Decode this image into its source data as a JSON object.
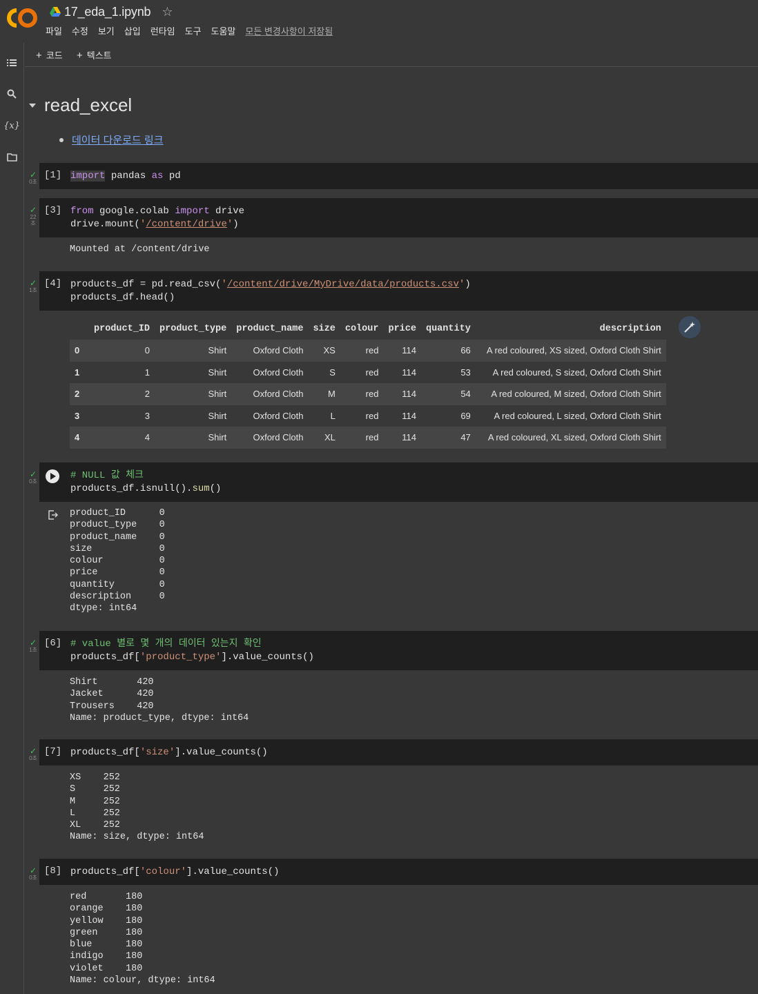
{
  "app": {
    "notebook_title": "17_eda_1.ipynb",
    "menu": [
      "파일",
      "수정",
      "보기",
      "삽입",
      "런타임",
      "도구",
      "도움말"
    ],
    "saved_status": "모든 변경사항이 저장됨"
  },
  "toolbar": {
    "add_code": "코드",
    "add_text": "텍스트"
  },
  "section": {
    "title": "read_excel",
    "link_text": "데이터 다운로드 링크"
  },
  "cells": [
    {
      "num": "[1]",
      "time": "0초",
      "lines": [
        "import pandas as pd"
      ]
    },
    {
      "num": "[3]",
      "time": "22\n초",
      "lines": [
        "from google.colab import drive",
        "drive.mount('/content/drive')"
      ],
      "output": [
        "Mounted at /content/drive"
      ]
    },
    {
      "num": "[4]",
      "time": "1초",
      "lines": [
        "products_df = pd.read_csv('/content/drive/MyDrive/data/products.csv')",
        "products_df.head()"
      ]
    },
    {
      "num": "",
      "time": "0초",
      "lines": [
        "# NULL 값 체크",
        "products_df.isnull().sum()"
      ],
      "output": [
        "product_ID      0",
        "product_type    0",
        "product_name    0",
        "size            0",
        "colour          0",
        "price           0",
        "quantity        0",
        "description     0",
        "dtype: int64"
      ]
    },
    {
      "num": "[6]",
      "time": "1초",
      "lines": [
        "# value 별로 몇 개의 데이터 있는지 확인",
        "products_df['product_type'].value_counts()"
      ],
      "output": [
        "Shirt       420",
        "Jacket      420",
        "Trousers    420",
        "Name: product_type, dtype: int64"
      ]
    },
    {
      "num": "[7]",
      "time": "0초",
      "lines": [
        "products_df['size'].value_counts()"
      ],
      "output": [
        "XS    252",
        "S     252",
        "M     252",
        "L     252",
        "XL    252",
        "Name: size, dtype: int64"
      ]
    },
    {
      "num": "[8]",
      "time": "0초",
      "lines": [
        "products_df['colour'].value_counts()"
      ],
      "output": [
        "red       180",
        "orange    180",
        "yellow    180",
        "green     180",
        "blue      180",
        "indigo    180",
        "violet    180",
        "Name: colour, dtype: int64"
      ]
    }
  ],
  "dataframe": {
    "columns": [
      "",
      "product_ID",
      "product_type",
      "product_name",
      "size",
      "colour",
      "price",
      "quantity",
      "description"
    ],
    "rows": [
      [
        "0",
        "0",
        "Shirt",
        "Oxford Cloth",
        "XS",
        "red",
        "114",
        "66",
        "A red coloured, XS sized, Oxford Cloth Shirt"
      ],
      [
        "1",
        "1",
        "Shirt",
        "Oxford Cloth",
        "S",
        "red",
        "114",
        "53",
        "A red coloured, S sized, Oxford Cloth Shirt"
      ],
      [
        "2",
        "2",
        "Shirt",
        "Oxford Cloth",
        "M",
        "red",
        "114",
        "54",
        "A red coloured, M sized, Oxford Cloth Shirt"
      ],
      [
        "3",
        "3",
        "Shirt",
        "Oxford Cloth",
        "L",
        "red",
        "114",
        "69",
        "A red coloured, L sized, Oxford Cloth Shirt"
      ],
      [
        "4",
        "4",
        "Shirt",
        "Oxford Cloth",
        "XL",
        "red",
        "114",
        "47",
        "A red coloured, XL sized, Oxford Cloth Shirt"
      ]
    ]
  },
  "colors": {
    "accent_link": "#7cacf8",
    "check": "#3fbf5f",
    "code_bg": "#1f1f1f",
    "page_bg": "#383838"
  },
  "icons": [
    "colab-logo-icon",
    "drive-icon",
    "star-icon",
    "toc-icon",
    "search-icon",
    "variables-icon",
    "folder-icon",
    "run-icon",
    "magic-wand-icon",
    "output-icon"
  ]
}
